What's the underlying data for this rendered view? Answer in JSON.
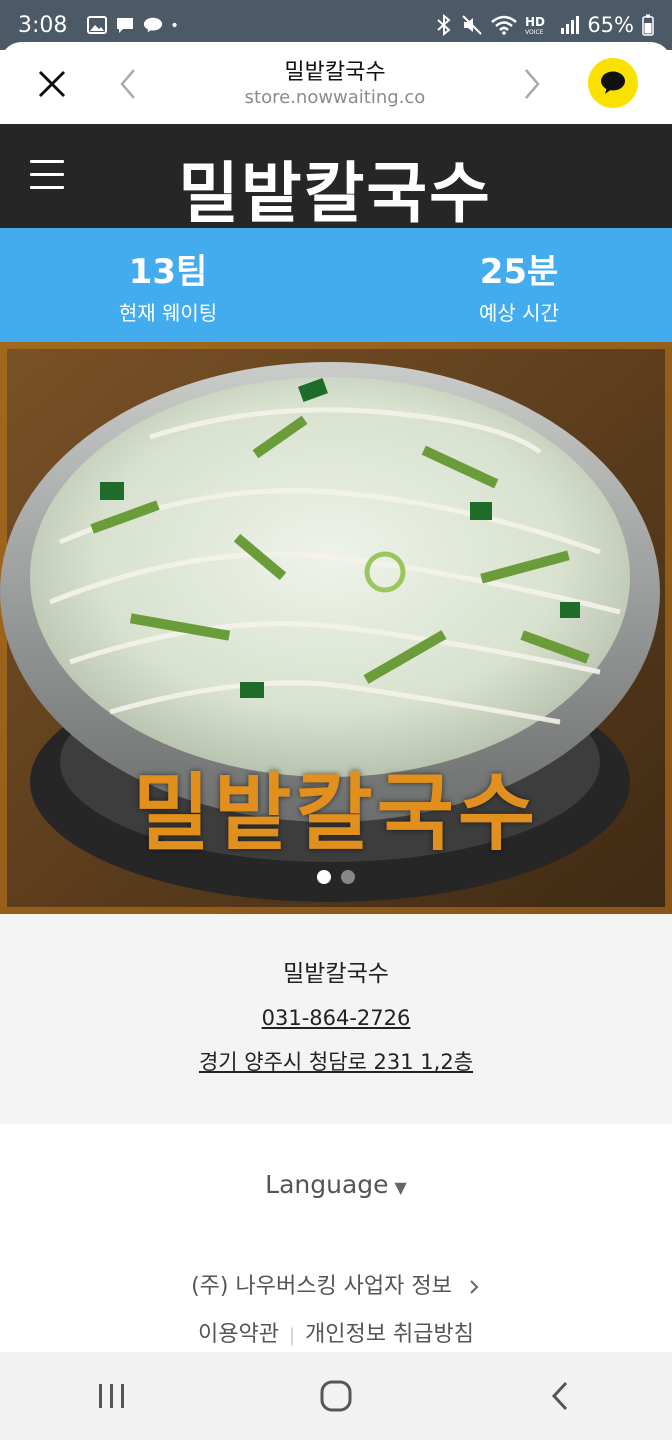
{
  "status_bar": {
    "time": "3:08",
    "battery": "65%",
    "icons": [
      "gallery-icon",
      "message-icon",
      "talk-icon",
      "dot-icon",
      "bluetooth-icon",
      "mute-icon",
      "wifi-icon",
      "hd-voice-icon",
      "signal-icon",
      "battery-icon"
    ]
  },
  "browser": {
    "title": "밀밭칼국수",
    "url": "store.nowwaiting.co"
  },
  "site": {
    "logo_text": "밀밭칼국수"
  },
  "wait": {
    "teams_value": "13팀",
    "teams_label": "현재 웨이팅",
    "time_value": "25분",
    "time_label": "예상 시간"
  },
  "hero": {
    "caption": "밀밭칼국수",
    "slide_count": 2,
    "active_slide": 1
  },
  "store": {
    "name": "밀밭칼국수",
    "phone": "031-864-2726",
    "address": "경기 양주시 청담로 231 1,2층"
  },
  "footer": {
    "language_label": "Language",
    "company_info": "(주) 나우버스킹 사업자 정보",
    "terms": "이용약관",
    "privacy": "개인정보 취급방침"
  },
  "colors": {
    "status_bar": "#4b5a66",
    "header_bg": "#262626",
    "wait_bg": "#43acee",
    "kakao_yellow": "#fae100",
    "caption_orange": "#e2901d"
  }
}
